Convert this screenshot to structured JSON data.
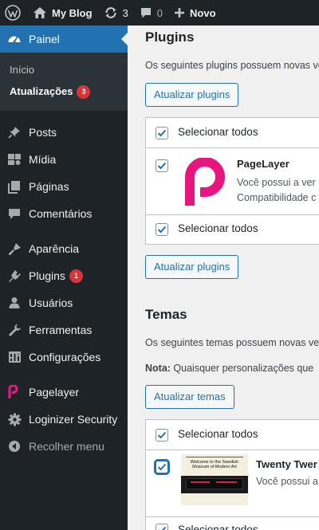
{
  "adminbar": {
    "site_name": "My Blog",
    "updates_count": "3",
    "comments_count": "0",
    "new_label": "Novo"
  },
  "sidebar": {
    "current_label": "Painel",
    "submenu": [
      {
        "label": "Início"
      },
      {
        "label": "Atualizações",
        "badge": "3"
      }
    ],
    "items": [
      {
        "label": "Posts",
        "icon": "pushpin-icon"
      },
      {
        "label": "Mídia",
        "icon": "media-icon"
      },
      {
        "label": "Páginas",
        "icon": "pages-icon"
      },
      {
        "label": "Comentários",
        "icon": "comments-icon"
      },
      {
        "label": "Aparência",
        "icon": "appearance-icon"
      },
      {
        "label": "Plugins",
        "icon": "plugins-icon",
        "badge": "1"
      },
      {
        "label": "Usuários",
        "icon": "users-icon"
      },
      {
        "label": "Ferramentas",
        "icon": "tools-icon"
      },
      {
        "label": "Configurações",
        "icon": "settings-icon"
      },
      {
        "label": "Pagelayer",
        "icon": "pagelayer-icon"
      },
      {
        "label": "Loginizer Security",
        "icon": "gear-icon"
      }
    ],
    "collapse_label": "Recolher menu"
  },
  "plugins": {
    "title": "Plugins",
    "description": "Os seguintes plugins possuem novas ve",
    "update_button": "Atualizar plugins",
    "select_all": "Selecionar todos",
    "item": {
      "name": "PageLayer",
      "line1": "Você possui a ver",
      "line2": "Compatibilidade c"
    }
  },
  "themes": {
    "title": "Temas",
    "description": "Os seguintes temas possuem novas ve",
    "note_label": "Nota:",
    "note_text": " Quaisquer personalizações que",
    "update_button": "Atualizar temas",
    "select_all": "Selecionar todos",
    "item": {
      "name": "Twenty Twer",
      "line1": "Você possui a",
      "thumb_caption": "Welcome to the Swedish Museum of Modern Art"
    }
  },
  "colors": {
    "adminbar_bg": "#1d2327",
    "menu_active": "#2271b1",
    "badge": "#d63638",
    "pagelayer_pink": "#e8157f"
  }
}
